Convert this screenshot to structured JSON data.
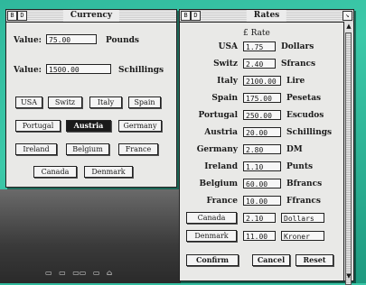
{
  "currency_window": {
    "title": "Currency",
    "value_label": "Value:",
    "value1": "75.00",
    "unit1": "Pounds",
    "value2": "1500.00",
    "unit2": "Schillings",
    "buttons": [
      {
        "label": "USA",
        "selected": false
      },
      {
        "label": "Switz",
        "selected": false
      },
      {
        "label": "Italy",
        "selected": false
      },
      {
        "label": "Spain",
        "selected": false
      },
      {
        "label": "Portugal",
        "selected": false
      },
      {
        "label": "Austria",
        "selected": true
      },
      {
        "label": "Germany",
        "selected": false
      },
      {
        "label": "Ireland",
        "selected": false
      },
      {
        "label": "Belgium",
        "selected": false
      },
      {
        "label": "France",
        "selected": false
      },
      {
        "label": "Canada",
        "selected": false
      },
      {
        "label": "Denmark",
        "selected": false
      }
    ],
    "title_icons": [
      "B",
      "D"
    ]
  },
  "rates_window": {
    "title": "Rates",
    "header": "£ Rate",
    "title_icons": [
      "B",
      "D"
    ],
    "rows": [
      {
        "country": "USA",
        "rate": "1.75",
        "unit": "Dollars"
      },
      {
        "country": "Switz",
        "rate": "2.40",
        "unit": "Sfrancs"
      },
      {
        "country": "Italy",
        "rate": "2100.00",
        "unit": "Lire"
      },
      {
        "country": "Spain",
        "rate": "175.00",
        "unit": "Pesetas"
      },
      {
        "country": "Portugal",
        "rate": "250.00",
        "unit": "Escudos"
      },
      {
        "country": "Austria",
        "rate": "20.00",
        "unit": "Schillings"
      },
      {
        "country": "Germany",
        "rate": "2.80",
        "unit": "DM"
      },
      {
        "country": "Ireland",
        "rate": "1.10",
        "unit": "Punts"
      },
      {
        "country": "Belgium",
        "rate": "60.00",
        "unit": "Bfrancs"
      },
      {
        "country": "France",
        "rate": "10.00",
        "unit": "Ffrancs"
      }
    ],
    "editable_rows": [
      {
        "country": "Canada",
        "rate": "2.10",
        "unit": "Dollars"
      },
      {
        "country": "Denmark",
        "rate": "11.00",
        "unit": "Kroner"
      }
    ],
    "confirm_label": "Confirm",
    "cancel_label": "Cancel",
    "reset_label": "Reset"
  },
  "desktop": {
    "icons": [
      "▭",
      "▭",
      "▭▭",
      "▭",
      "⌂"
    ]
  }
}
